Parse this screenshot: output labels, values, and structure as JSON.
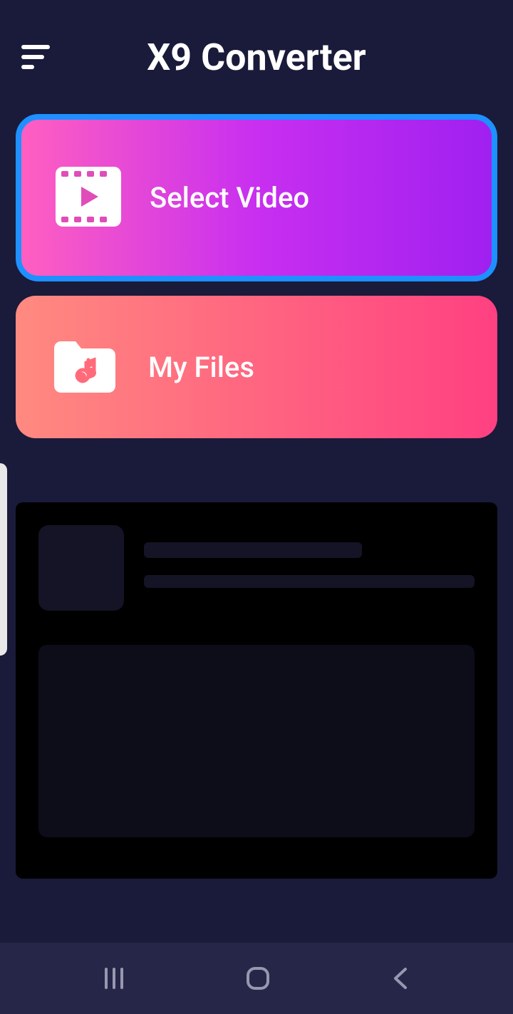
{
  "header": {
    "title": "X9 Converter"
  },
  "cards": {
    "select_video": {
      "label": "Select Video"
    },
    "my_files": {
      "label": "My Files"
    }
  }
}
